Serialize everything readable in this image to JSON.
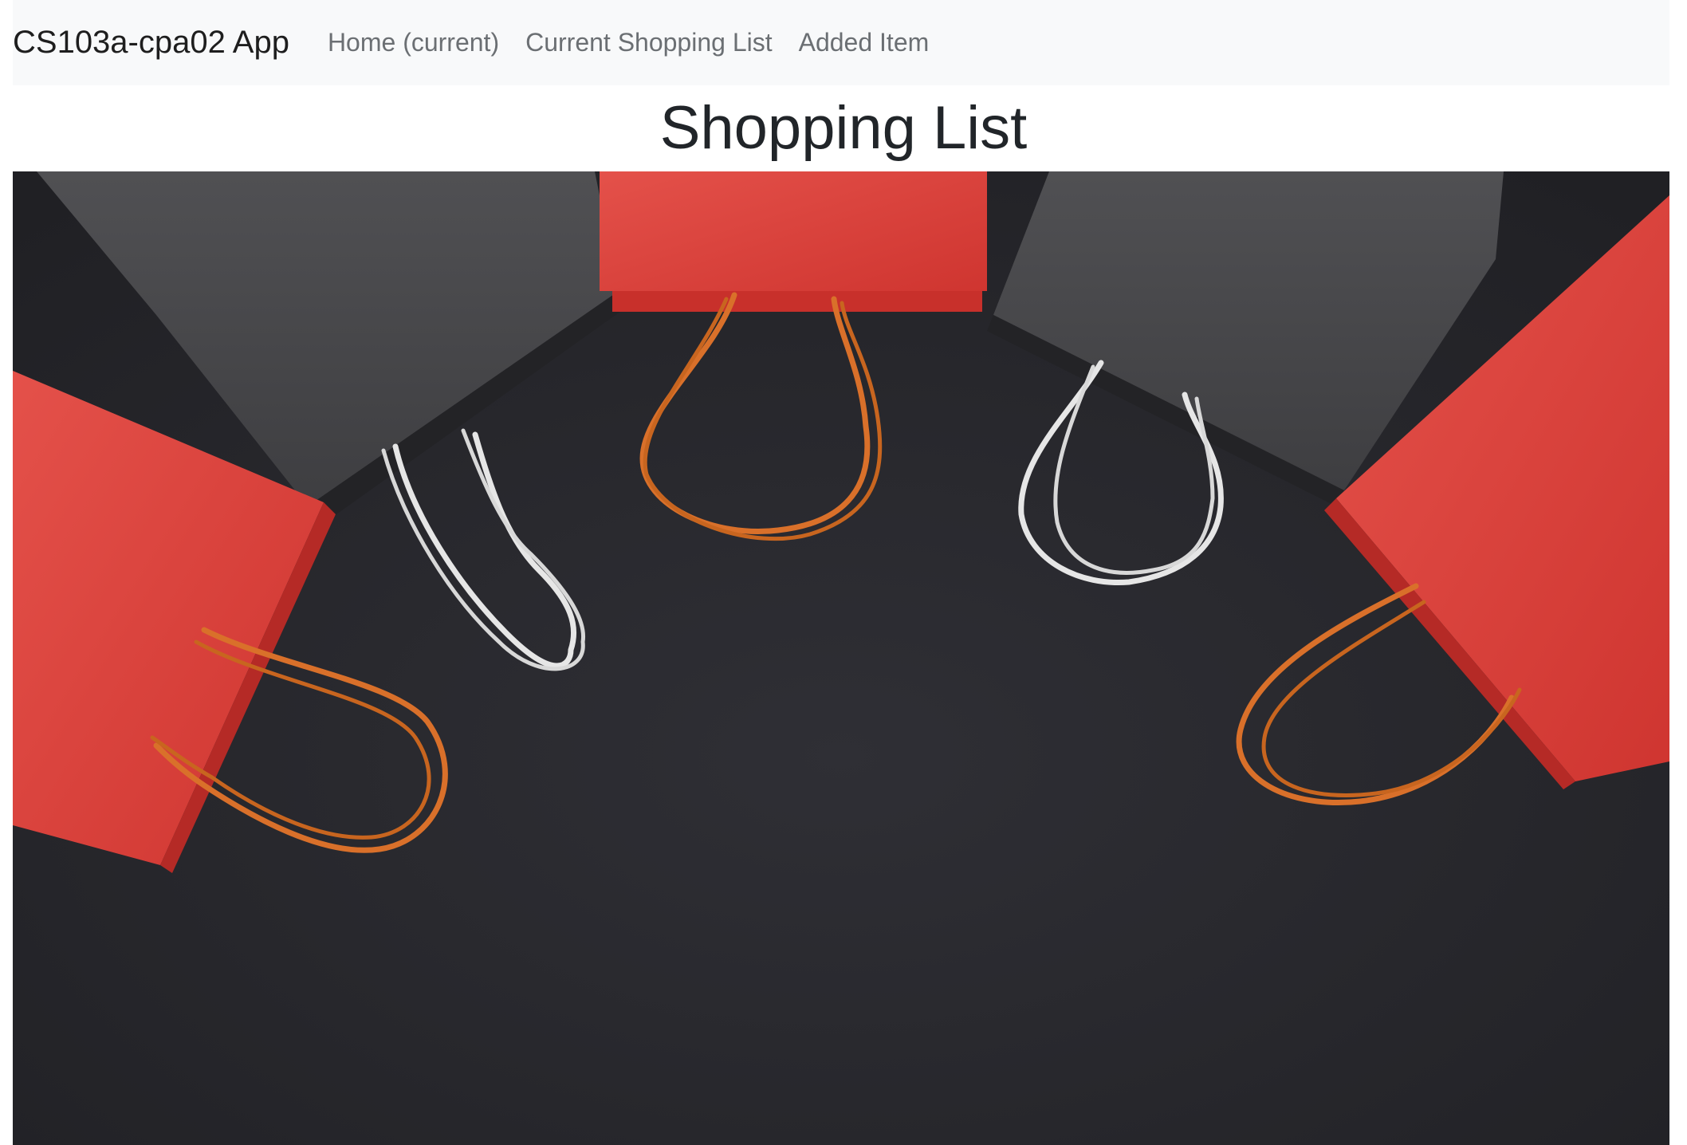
{
  "navbar": {
    "brand": "CS103a-cpa02 App",
    "links": [
      {
        "label": "Home (current)"
      },
      {
        "label": "Current Shopping List"
      },
      {
        "label": "Added Item"
      }
    ]
  },
  "main": {
    "title": "Shopping List"
  },
  "colors": {
    "navbar_bg": "#f8f9fa",
    "bag_red": "#e0463f",
    "bag_gray": "#4a4a4c",
    "background_dark": "#2a2a2f",
    "handle_orange": "#d9702a",
    "handle_white": "#e6e6e6"
  }
}
